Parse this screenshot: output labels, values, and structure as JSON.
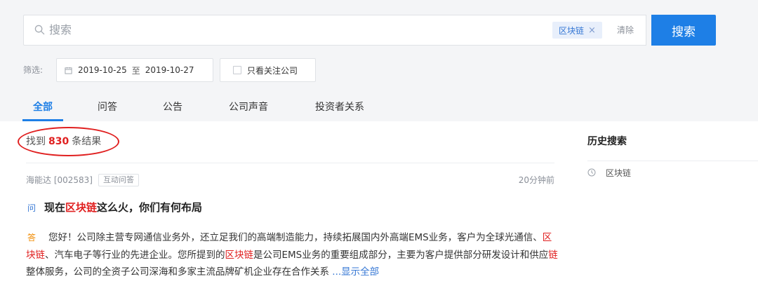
{
  "search": {
    "placeholder": "搜索",
    "tag": "区块链",
    "tag_close": "×",
    "clear": "清除",
    "button": "搜索"
  },
  "filter": {
    "label": "筛选:",
    "date_from": "2019-10-25",
    "date_sep": "至",
    "date_to": "2019-10-27",
    "follow_only": "只看关注公司"
  },
  "tabs": [
    {
      "label": "全部",
      "active": true
    },
    {
      "label": "问答",
      "active": false
    },
    {
      "label": "公告",
      "active": false
    },
    {
      "label": "公司声音",
      "active": false
    },
    {
      "label": "投资者关系",
      "active": false
    }
  ],
  "results": {
    "prefix": "找到",
    "count": "830",
    "suffix": "条结果"
  },
  "item": {
    "source": "海能达 [002583]",
    "type": "互动问答",
    "time": "20分钟前",
    "q_mark": "问",
    "title_pre": "现在",
    "title_hl": "区块链",
    "title_post": "这么火，你们有何布局",
    "a_mark": "答",
    "answer_1": "您好！公司除主营专网通信业务外，还立足我们的高端制造能力，持续拓展国内外高端EMS业务，客户为全球光通信、",
    "answer_hl_1": "区块链",
    "answer_2": "、汽车电子等行业的先进企业。您所提到的",
    "answer_hl_2": "区块链",
    "answer_3": "是公司EMS业务的重要组成部分，主要为客户提供部分研发设计和供应",
    "answer_hl_3": "链",
    "answer_4": "整体服务，公司的全资子公司深海和多家主流品牌矿机企业存在合作关系",
    "show_all": "...显示全部"
  },
  "sidebar": {
    "title": "历史搜索",
    "history": [
      "区块链"
    ]
  },
  "colors": {
    "accent": "#1e7fe6",
    "highlight": "#e02020",
    "answer_mark": "#f08a00"
  },
  "icons": [
    "search-icon",
    "calendar-icon",
    "close-icon",
    "clock-icon",
    "checkbox"
  ]
}
